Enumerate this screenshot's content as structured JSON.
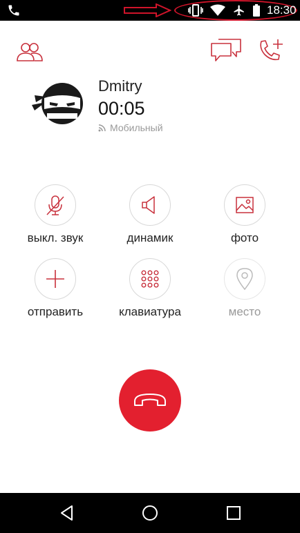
{
  "status_bar": {
    "time": "18:30",
    "icons": [
      "phone-icon",
      "vibrate-icon",
      "wifi-icon",
      "airplane-icon",
      "battery-icon"
    ],
    "highlight_color": "#d0142a"
  },
  "header": {
    "icons": [
      "contacts-icon",
      "chat-icon",
      "add-call-icon"
    ]
  },
  "caller": {
    "name": "Dmitry",
    "duration": "00:05",
    "network_label": "Мобильный",
    "avatar_icon": "ninja-avatar-icon"
  },
  "actions": [
    {
      "label": "выкл. звук",
      "icon": "mic-off-icon",
      "enabled": true
    },
    {
      "label": "динамик",
      "icon": "speaker-icon",
      "enabled": true
    },
    {
      "label": "фото",
      "icon": "photo-icon",
      "enabled": true
    },
    {
      "label": "отправить",
      "icon": "plus-icon",
      "enabled": true
    },
    {
      "label": "клавиатура",
      "icon": "keypad-icon",
      "enabled": true
    },
    {
      "label": "место",
      "icon": "location-icon",
      "enabled": false
    }
  ],
  "end_call": {
    "icon": "hangup-icon",
    "color": "#e3202f"
  },
  "nav_bar": {
    "icons": [
      "back-icon",
      "home-icon",
      "recents-icon"
    ]
  },
  "colors": {
    "accent": "#c8303c",
    "end_call": "#e3202f",
    "muted_text": "#999999"
  }
}
